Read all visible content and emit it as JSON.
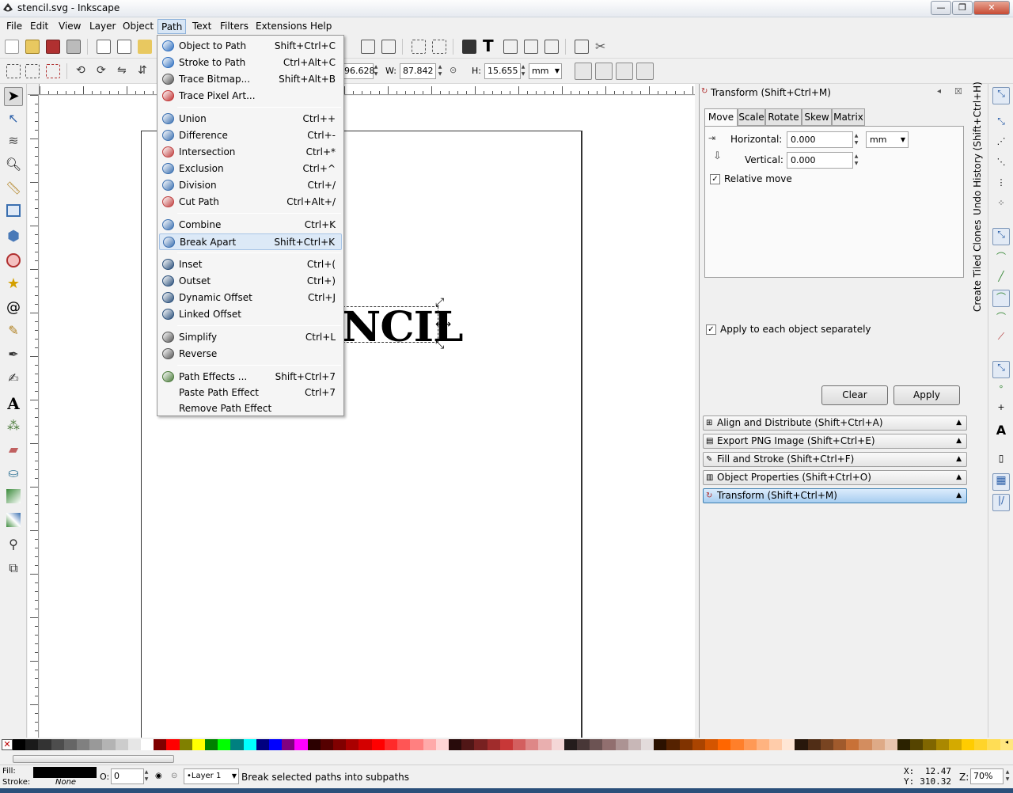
{
  "window": {
    "title": "stencil.svg - Inkscape",
    "buttons": [
      "—",
      "❐",
      "✕"
    ]
  },
  "menubar": [
    "File",
    "Edit",
    "View",
    "Layer",
    "Object",
    "Path",
    "Text",
    "Filters",
    "Extensions",
    "Help"
  ],
  "toolbar2": {
    "x_value": "96.628",
    "w_label": "W:",
    "w_value": "87.842",
    "h_label": "H:",
    "h_value": "15.655",
    "unit": "mm"
  },
  "canvas": {
    "text": "NCIL"
  },
  "path_menu": [
    {
      "label": "Object to Path",
      "accel": "Shift+Ctrl+C",
      "icon": "object-to-path-icon",
      "color": "#2f6fbf"
    },
    {
      "label": "Stroke to Path",
      "accel": "Ctrl+Alt+C",
      "icon": "stroke-to-path-icon",
      "color": "#2f6fbf"
    },
    {
      "label": "Trace Bitmap...",
      "accel": "Shift+Alt+B",
      "icon": "trace-bitmap-icon",
      "color": "#555555"
    },
    {
      "label": "Trace Pixel Art...",
      "accel": "",
      "icon": "trace-pixel-art-icon",
      "color": "#c03030"
    },
    {
      "sep": true
    },
    {
      "label": "Union",
      "accel": "Ctrl++",
      "icon": "union-icon",
      "color": "#3a6fb0"
    },
    {
      "label": "Difference",
      "accel": "Ctrl+-",
      "icon": "difference-icon",
      "color": "#3a6fb0"
    },
    {
      "label": "Intersection",
      "accel": "Ctrl+*",
      "icon": "intersection-icon",
      "color": "#c04040"
    },
    {
      "label": "Exclusion",
      "accel": "Ctrl+^",
      "icon": "exclusion-icon",
      "color": "#3a6fb0"
    },
    {
      "label": "Division",
      "accel": "Ctrl+/",
      "icon": "division-icon",
      "color": "#3a6fb0"
    },
    {
      "label": "Cut Path",
      "accel": "Ctrl+Alt+/",
      "icon": "cut-path-icon",
      "color": "#c04040"
    },
    {
      "sep": true
    },
    {
      "label": "Combine",
      "accel": "Ctrl+K",
      "icon": "combine-icon",
      "color": "#3a6fb0"
    },
    {
      "label": "Break Apart",
      "accel": "Shift+Ctrl+K",
      "icon": "break-apart-icon",
      "color": "#3a6fb0",
      "highlight": true
    },
    {
      "sep": true
    },
    {
      "label": "Inset",
      "accel": "Ctrl+(",
      "icon": "inset-icon",
      "color": "#2a4f7a"
    },
    {
      "label": "Outset",
      "accel": "Ctrl+)",
      "icon": "outset-icon",
      "color": "#2a4f7a"
    },
    {
      "label": "Dynamic Offset",
      "accel": "Ctrl+J",
      "icon": "dynamic-offset-icon",
      "color": "#2a4f7a"
    },
    {
      "label": "Linked Offset",
      "accel": "",
      "icon": "linked-offset-icon",
      "color": "#2a4f7a"
    },
    {
      "sep": true
    },
    {
      "label": "Simplify",
      "accel": "Ctrl+L",
      "icon": "simplify-icon",
      "color": "#555555"
    },
    {
      "label": "Reverse",
      "accel": "",
      "icon": "reverse-icon",
      "color": "#555555"
    },
    {
      "sep": true
    },
    {
      "label": "Path Effects ...",
      "accel": "Shift+Ctrl+7",
      "icon": "path-effects-icon",
      "color": "#4a7a3a"
    },
    {
      "label": "Paste Path Effect",
      "accel": "Ctrl+7",
      "icon": "",
      "color": ""
    },
    {
      "label": "Remove Path Effect",
      "accel": "",
      "icon": "",
      "color": ""
    }
  ],
  "transform": {
    "title": "Transform (Shift+Ctrl+M)",
    "tabs": [
      "Move",
      "Scale",
      "Rotate",
      "Skew",
      "Matrix"
    ],
    "horizontal_label": "Horizontal:",
    "horizontal_value": "0.000",
    "vertical_label": "Vertical:",
    "vertical_value": "0.000",
    "unit": "mm",
    "relative_move": "Relative move",
    "apply_each": "Apply to each object separately",
    "clear": "Clear",
    "apply": "Apply"
  },
  "dock_bars": [
    {
      "label": "Align and Distribute (Shift+Ctrl+A)"
    },
    {
      "label": "Export PNG Image (Shift+Ctrl+E)"
    },
    {
      "label": "Fill and Stroke (Shift+Ctrl+F)"
    },
    {
      "label": "Object Properties (Shift+Ctrl+O)"
    },
    {
      "label": "Transform (Shift+Ctrl+M)",
      "active": true
    }
  ],
  "vtabs": {
    "undo": "Undo History (Shift+Ctrl+H)",
    "tiled": "Create Tiled Clones"
  },
  "status": {
    "fill_label": "Fill:",
    "stroke_label": "Stroke:",
    "stroke_value": "None",
    "opacity_label": "O:",
    "opacity_value": "0",
    "layer": "•Layer 1",
    "message": "Break selected paths into subpaths",
    "x_label": "X:",
    "x_value": "12.47",
    "y_label": "Y:",
    "y_value": "310.32",
    "zoom_label": "Z:",
    "zoom_value": "70%"
  },
  "palette": [
    "#000000",
    "#1a1a1a",
    "#333333",
    "#4d4d4d",
    "#666666",
    "#808080",
    "#999999",
    "#b3b3b3",
    "#cccccc",
    "#e6e6e6",
    "#ffffff",
    "#800000",
    "#ff0000",
    "#808000",
    "#ffff00",
    "#008000",
    "#00ff00",
    "#008080",
    "#00ffff",
    "#000080",
    "#0000ff",
    "#800080",
    "#ff00ff",
    "#2b0000",
    "#550000",
    "#800000",
    "#aa0000",
    "#d40000",
    "#ff0000",
    "#ff2a2a",
    "#ff5555",
    "#ff8080",
    "#ffaaaa",
    "#ffd5d5",
    "#280b0b",
    "#501616",
    "#782121",
    "#a02c2c",
    "#c83737",
    "#d35f5f",
    "#de8787",
    "#e9afaf",
    "#f4d7d7",
    "#241c1c",
    "#483737",
    "#6c5353",
    "#916f6f",
    "#ac9393",
    "#c8b7b7",
    "#e3dbdb",
    "#2b1100",
    "#552200",
    "#803300",
    "#aa4400",
    "#d45500",
    "#ff6600",
    "#ff7f2a",
    "#ff9955",
    "#ffb380",
    "#ffccaa",
    "#ffe6d5",
    "#28170b",
    "#502d16",
    "#784421",
    "#a05a2c",
    "#c87137",
    "#d38d5f",
    "#deaa87",
    "#e9c6af",
    "#2b2200",
    "#554400",
    "#806600",
    "#aa8800",
    "#d4aa00",
    "#ffcc00",
    "#ffd42a",
    "#ffdd55",
    "#ffe680"
  ]
}
